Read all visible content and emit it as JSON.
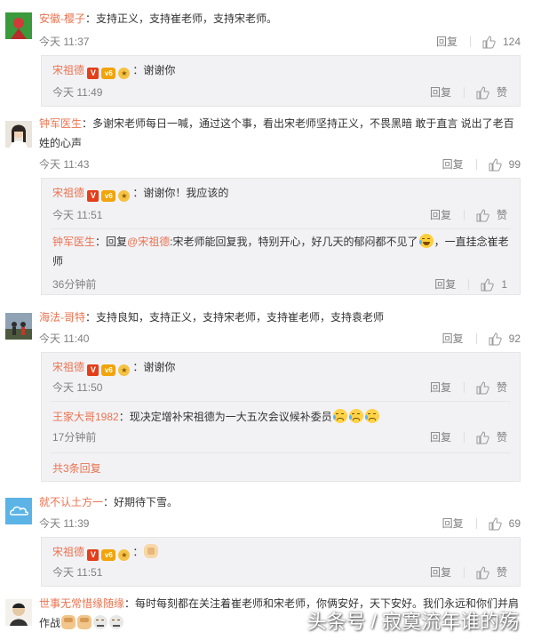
{
  "comments": [
    {
      "username": "安徽-樱子",
      "text": "：支持正义，支持崔老师，支持宋老师。",
      "time": "今天 11:37",
      "reply_label": "回复",
      "likes": "124",
      "replies": [
        {
          "username": "宋祖德",
          "text": "：谢谢你",
          "time": "今天 11:49",
          "reply_label": "回复",
          "likes": "赞"
        }
      ]
    },
    {
      "username": "钟军医生",
      "text": "：多谢宋老师每日一喊，通过这个事，看出宋老师坚持正义，不畏黑暗  敢于直言  说出了老百姓的心声",
      "time": "今天 11:43",
      "reply_label": "回复",
      "likes": "99",
      "replies": [
        {
          "username": "宋祖德",
          "text": "：谢谢你！我应该的",
          "time": "今天 11:51",
          "reply_label": "回复",
          "likes": "赞"
        },
        {
          "username": "钟军医生",
          "prefix": "：回复",
          "mention": "@宋祖德",
          "text": ":宋老师能回复我，特别开心，好几天的郁闷都不见了",
          "text2": "，一直挂念崔老师",
          "time": "36分钟前",
          "reply_label": "回复",
          "likes": "1"
        }
      ]
    },
    {
      "username": "海法-哥特",
      "text": "：支持良知，支持正义，支持宋老师，支持崔老师，支持袁老师",
      "time": "今天 11:40",
      "reply_label": "回复",
      "likes": "92",
      "replies": [
        {
          "username": "宋祖德",
          "text": "：谢谢你",
          "time": "今天 11:50",
          "reply_label": "回复",
          "likes": "赞"
        },
        {
          "username": "王家大哥1982",
          "text": "：现决定增补宋祖德为一大五次会议候补委员",
          "time": "17分钟前",
          "reply_label": "回复",
          "likes": "赞"
        }
      ],
      "more_label": "共3条回复"
    },
    {
      "username": "就不认土方一",
      "text": "：好期待下雪。",
      "time": "今天 11:39",
      "reply_label": "回复",
      "likes": "69",
      "replies": [
        {
          "username": "宋祖德",
          "text": "：",
          "time": "今天 11:51",
          "reply_label": "回复",
          "likes": "赞"
        }
      ]
    },
    {
      "username": "世事无常惜缘随缘",
      "text": "：每时每刻都在关注着崔老师和宋老师，你俩安好，天下安好。我们永远和你们并肩作战"
    }
  ],
  "watermark": "头条号 / 寂寞流年谁的殇",
  "colors": {
    "username": "#eb7350",
    "meta": "#808080",
    "reply_bg": "#f2f2f5"
  },
  "icons": {
    "like": "thumbs-up-icon",
    "v_badge": "verified-v-icon",
    "vip": "vip-icon",
    "medal": "medal-icon"
  }
}
